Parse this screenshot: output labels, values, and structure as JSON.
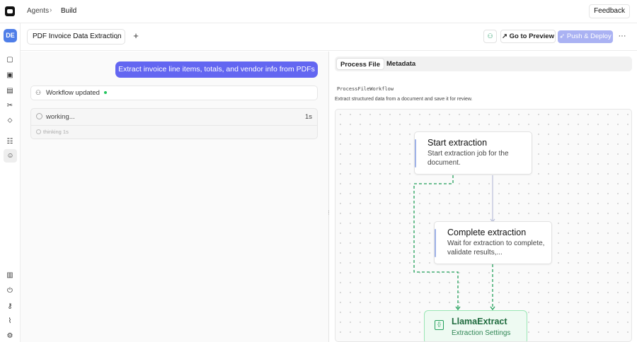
{
  "breadcrumb": {
    "items": [
      "Agents",
      "Build"
    ]
  },
  "header": {
    "feedback_label": "Feedback"
  },
  "sidebar": {
    "avatar_initials": "DE"
  },
  "subbar": {
    "workflow_name": "PDF Invoice Data Extraction",
    "preview_label": "Go to Preview",
    "deploy_label": "Push & Deploy"
  },
  "chat": {
    "user_message": "Extract invoice line items, totals, and vendor info from PDFs",
    "workflow_status": "Workflow updated",
    "working_label": "working...",
    "working_time": "1s",
    "thinking_label": "thinking 1s"
  },
  "panel": {
    "tabs": [
      "Process File",
      "Metadata"
    ],
    "active_tab": "Process File",
    "workflow_class": "ProcessFileWorkflow",
    "workflow_description": "Extract structured data from a document and save it for review."
  },
  "canvas": {
    "nodes": [
      {
        "title": "Start extraction",
        "description": "Start extraction job for the document."
      },
      {
        "title": "Complete extraction",
        "description": "Wait for extraction to complete, validate results,..."
      },
      {
        "title": "LlamaExtract",
        "description": "Extraction Settings"
      }
    ]
  },
  "colors": {
    "accent": "#6366f1",
    "deploy_disabled": "#aab2f3",
    "edge_dashed": "#22a05a",
    "edge_solid": "#b9bfd9"
  }
}
